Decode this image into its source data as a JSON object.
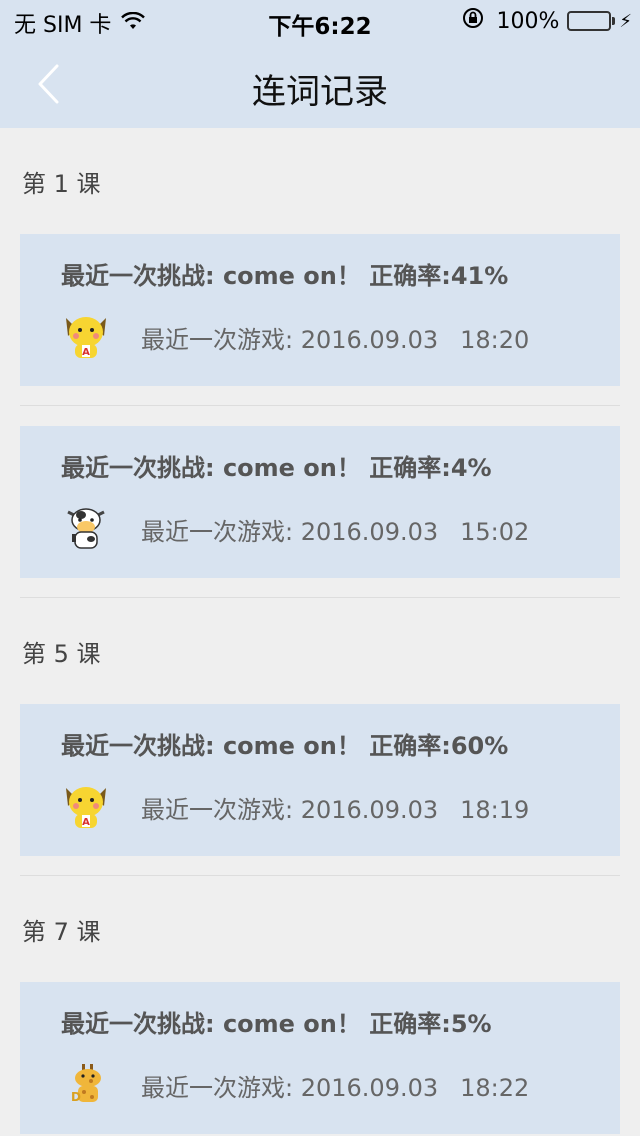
{
  "status_bar": {
    "carrier": "无 SIM 卡",
    "time": "下午6:22",
    "battery": "100%"
  },
  "nav": {
    "title": "连词记录",
    "accent": "#d8e3f0"
  },
  "sections": [
    {
      "lesson": "第 1 课",
      "records": [
        {
          "challenge": "最近一次挑战: come on！ 正确率:41%",
          "last_game_label": "最近一次游戏: 2016.09.03",
          "time": "18:20",
          "avatar": "yellow-puppy-avatar"
        },
        {
          "challenge": "最近一次挑战: come on！ 正确率:4%",
          "last_game_label": "最近一次游戏: 2016.09.03",
          "time": "15:02",
          "avatar": "cow-avatar"
        }
      ]
    },
    {
      "lesson": "第 5 课",
      "records": [
        {
          "challenge": "最近一次挑战: come on！ 正确率:60%",
          "last_game_label": "最近一次游戏: 2016.09.03",
          "time": "18:19",
          "avatar": "yellow-puppy-avatar"
        }
      ]
    },
    {
      "lesson": "第 7 课",
      "records": [
        {
          "challenge": "最近一次挑战: come on！ 正确率:5%",
          "last_game_label": "最近一次游戏: 2016.09.03",
          "time": "18:22",
          "avatar": "giraffe-avatar"
        }
      ]
    }
  ]
}
